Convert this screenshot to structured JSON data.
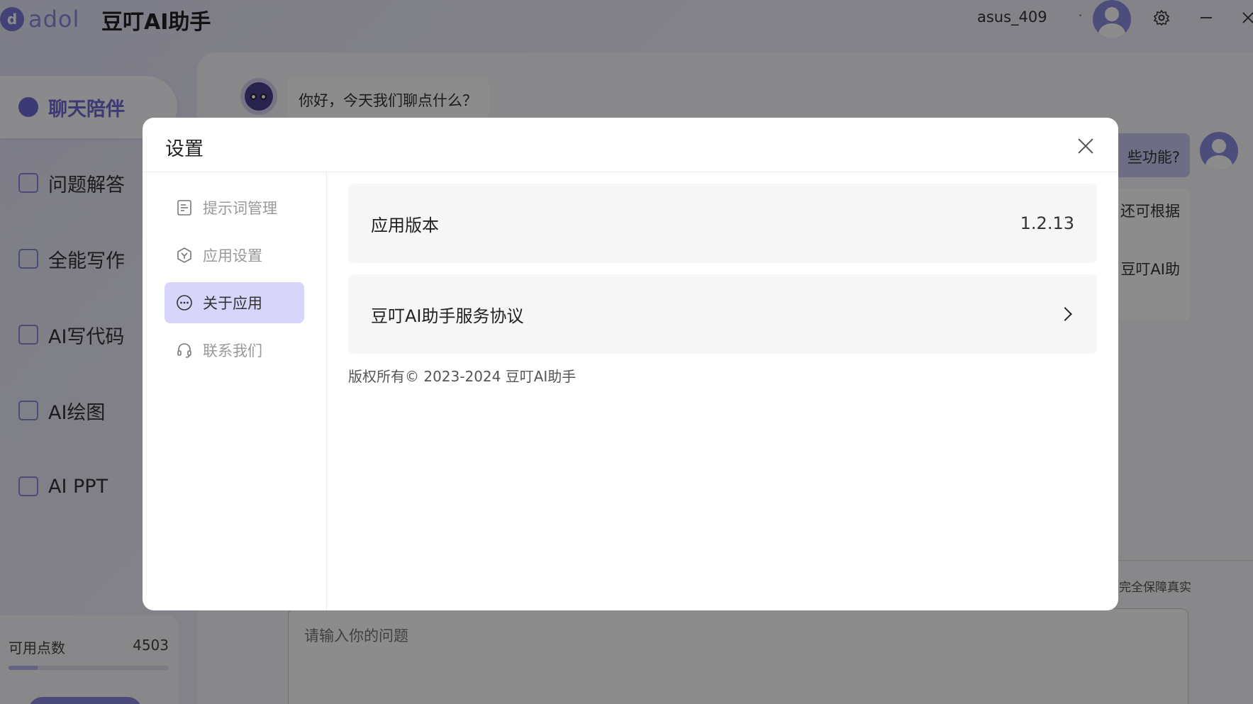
{
  "app": {
    "logo_mark": "d",
    "logo_text": "adol",
    "title": "豆叮AI助手",
    "username": "asus_409"
  },
  "sidebar": {
    "items": [
      {
        "label": "聊天陪伴",
        "icon": "chat-bubble-icon",
        "active": true
      },
      {
        "label": "问题解答",
        "icon": "qa-list-icon"
      },
      {
        "label": "全能写作",
        "icon": "pen-document-icon"
      },
      {
        "label": "AI写代码",
        "icon": "code-folder-icon"
      },
      {
        "label": "AI绘图",
        "icon": "image-chart-icon"
      },
      {
        "label": "AI PPT",
        "icon": "ppt-file-icon"
      }
    ],
    "points_label": "可用点数",
    "points_value": "4503"
  },
  "chat": {
    "greeting": "你好，今天我们聊点什么？",
    "user_question_fragment": "些功能?",
    "reply_fragment_1": "还可根据",
    "reply_fragment_2": "豆叮AI助",
    "disclaimer_fragment": "完全保障真实",
    "input_placeholder": "请输入你的问题"
  },
  "modal": {
    "title": "设置",
    "menu": [
      {
        "label": "提示词管理",
        "icon": "document-list-icon"
      },
      {
        "label": "应用设置",
        "icon": "hexagon-settings-icon"
      },
      {
        "label": "关于应用",
        "icon": "more-circle-icon",
        "active": true
      },
      {
        "label": "联系我们",
        "icon": "headset-icon"
      }
    ],
    "version_label": "应用版本",
    "version_value": "1.2.13",
    "agreement_label": "豆叮AI助手服务协议",
    "copyright": "版权所有© 2023-2024 豆叮AI助手"
  }
}
